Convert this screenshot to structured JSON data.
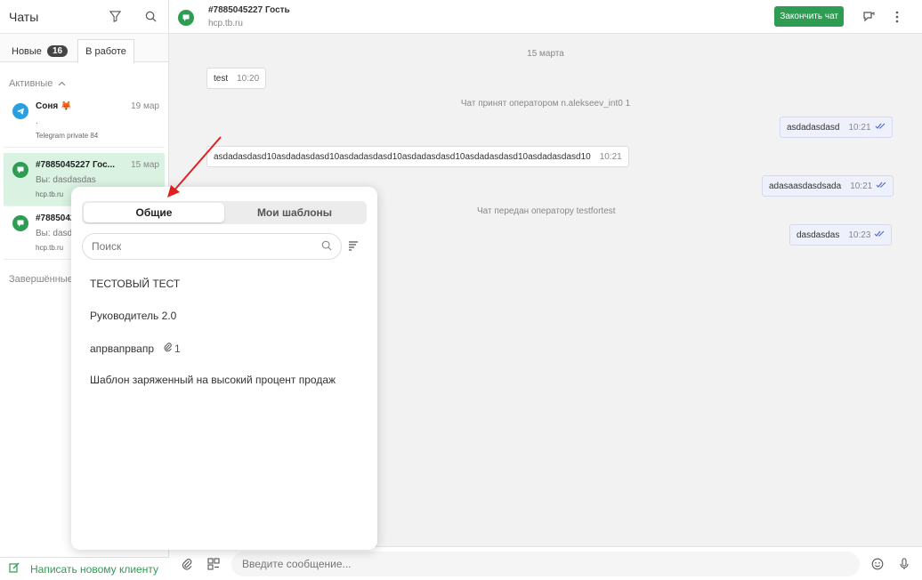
{
  "sidebar": {
    "title": "Чаты",
    "tabs": [
      {
        "label": "Новые",
        "count": "16"
      },
      {
        "label": "В работе"
      }
    ],
    "active_group": "Активные",
    "chats": [
      {
        "name": "Соня 🦊",
        "date": "19 мар",
        "preview": ".",
        "sub": "Telegram private 84",
        "channel": "telegram"
      },
      {
        "name": "#7885045227 Гос...",
        "date": "15 мар",
        "preview": "Вы: dasdasdas",
        "sub": "hcp.tb.ru",
        "channel": "chat"
      },
      {
        "name": "#7885042...",
        "date": "",
        "preview": "Вы: dasd...",
        "sub": "hcp.tb.ru",
        "channel": "chat"
      }
    ],
    "finished_group": "Завершённые",
    "footer_label": "Написать новому клиенту"
  },
  "header": {
    "title": "#7885045227 Гость",
    "subtitle": "hcp.tb.ru",
    "end_button": "Закончить чат"
  },
  "messages": {
    "date_separator": "15 марта",
    "m1": {
      "text": "test",
      "time": "10:20"
    },
    "sys1": "Чат принят оператором n.alekseev_int0 1",
    "m2": {
      "text": "asdadasdasd",
      "time": "10:21"
    },
    "m3": {
      "text": "asdadasdasd10asdadasdasd10asdadasdasd10asdadasdasd10asdadasdasd10asdadasdasd10",
      "time": "10:21"
    },
    "m4": {
      "text": "adasaasdasdsada",
      "time": "10:21"
    },
    "sys2": "Чат передан оператору testfortest",
    "m5": {
      "text": "dasdasdas",
      "time": "10:23"
    }
  },
  "composer": {
    "placeholder": "Введите сообщение..."
  },
  "templates_popup": {
    "tabs": [
      "Общие",
      "Мои шаблоны"
    ],
    "search_placeholder": "Поиск",
    "items": [
      {
        "label": "ТЕСТОВЫЙ ТЕСТ"
      },
      {
        "label": "Руководитель 2.0"
      },
      {
        "label": "апрвапрвапр",
        "attachments": "1"
      },
      {
        "label": "Шаблон заряженный на высокий процент продаж"
      }
    ]
  },
  "colors": {
    "accent_green": "#2e9c53",
    "selected_bg": "#d9f2e2",
    "outgoing_bg": "#eef0fb",
    "arrow": "#e02020"
  }
}
